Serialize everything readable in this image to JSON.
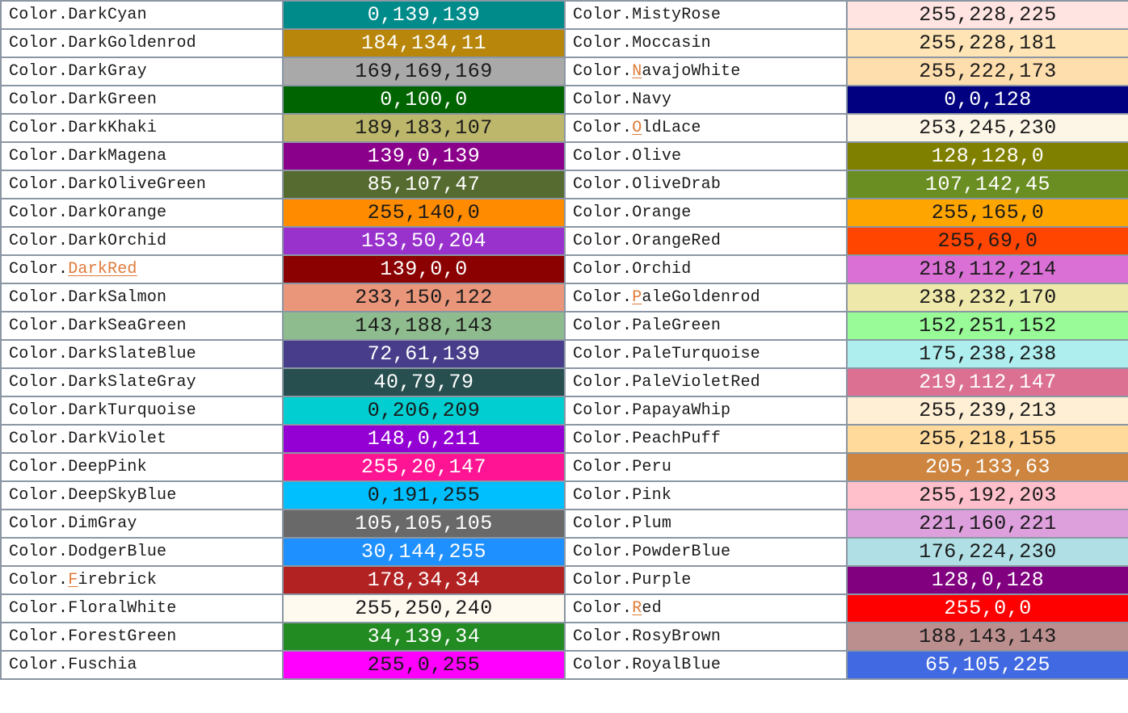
{
  "accent_color": "#e07b39",
  "rows": [
    {
      "left": {
        "prefix": "Color.",
        "name": "DarkCyan",
        "rgb": "0,139,139",
        "bg": "#008b8b",
        "fg": "#ffffff"
      },
      "right": {
        "prefix": "Color.",
        "name": "MistyRose",
        "rgb": "255,228,225",
        "bg": "#ffe4e1",
        "fg": "#1a1a1a"
      }
    },
    {
      "left": {
        "prefix": "Color.",
        "name": "DarkGoldenrod",
        "rgb": "184,134,11",
        "bg": "#b8860b",
        "fg": "#ffffff"
      },
      "right": {
        "prefix": "Color.",
        "name": "Moccasin",
        "rgb": "255,228,181",
        "bg": "#ffe4b5",
        "fg": "#1a1a1a"
      }
    },
    {
      "left": {
        "prefix": "Color.",
        "name": "DarkGray",
        "rgb": "169,169,169",
        "bg": "#a9a9a9",
        "fg": "#1a1a1a"
      },
      "right": {
        "prefix": "Color.",
        "name": "NavajoWhite",
        "rgb": "255,222,173",
        "bg": "#ffdead",
        "fg": "#1a1a1a",
        "mark": "first-letter"
      }
    },
    {
      "left": {
        "prefix": "Color.",
        "name": "DarkGreen",
        "rgb": "0,100,0",
        "bg": "#006400",
        "fg": "#ffffff"
      },
      "right": {
        "prefix": "Color.",
        "name": "Navy",
        "rgb": "0,0,128",
        "bg": "#000080",
        "fg": "#ffffff"
      }
    },
    {
      "left": {
        "prefix": "Color.",
        "name": "DarkKhaki",
        "rgb": "189,183,107",
        "bg": "#bdb76b",
        "fg": "#1a1a1a"
      },
      "right": {
        "prefix": "Color.",
        "name": "OldLace",
        "rgb": "253,245,230",
        "bg": "#fdf5e6",
        "fg": "#1a1a1a",
        "mark": "first-letter"
      }
    },
    {
      "left": {
        "prefix": "Color.",
        "name": "DarkMagena",
        "rgb": "139,0,139",
        "bg": "#8b008b",
        "fg": "#ffffff"
      },
      "right": {
        "prefix": "Color.",
        "name": "Olive",
        "rgb": "128,128,0",
        "bg": "#808000",
        "fg": "#ffffff"
      }
    },
    {
      "left": {
        "prefix": "Color.",
        "name": "DarkOliveGreen",
        "rgb": "85,107,47",
        "bg": "#556b2f",
        "fg": "#ffffff"
      },
      "right": {
        "prefix": "Color.",
        "name": "OliveDrab",
        "rgb": "107,142,45",
        "bg": "#6b8e23",
        "fg": "#ffffff"
      }
    },
    {
      "left": {
        "prefix": "Color.",
        "name": "DarkOrange",
        "rgb": "255,140,0",
        "bg": "#ff8c00",
        "fg": "#1a1a1a"
      },
      "right": {
        "prefix": "Color.",
        "name": "Orange",
        "rgb": "255,165,0",
        "bg": "#ffa500",
        "fg": "#1a1a1a"
      }
    },
    {
      "left": {
        "prefix": "Color.",
        "name": "DarkOrchid",
        "rgb": "153,50,204",
        "bg": "#9932cc",
        "fg": "#ffffff"
      },
      "right": {
        "prefix": "Color.",
        "name": "OrangeRed",
        "rgb": "255,69,0",
        "bg": "#ff4500",
        "fg": "#1a1a1a"
      }
    },
    {
      "left": {
        "prefix": "Color.",
        "name": "DarkRed",
        "rgb": "139,0,0",
        "bg": "#8b0000",
        "fg": "#ffffff",
        "mark": "whole"
      },
      "right": {
        "prefix": "Color.",
        "name": "Orchid",
        "rgb": "218,112,214",
        "bg": "#da70d6",
        "fg": "#1a1a1a"
      }
    },
    {
      "left": {
        "prefix": "Color.",
        "name": "DarkSalmon",
        "rgb": "233,150,122",
        "bg": "#e9967a",
        "fg": "#1a1a1a"
      },
      "right": {
        "prefix": "Color.",
        "name": "PaleGoldenrod",
        "rgb": "238,232,170",
        "bg": "#eee8aa",
        "fg": "#1a1a1a",
        "mark": "first-letter"
      }
    },
    {
      "left": {
        "prefix": "Color.",
        "name": "DarkSeaGreen",
        "rgb": "143,188,143",
        "bg": "#8fbc8f",
        "fg": "#1a1a1a"
      },
      "right": {
        "prefix": "Color.",
        "name": "PaleGreen",
        "rgb": "152,251,152",
        "bg": "#98fb98",
        "fg": "#1a1a1a"
      }
    },
    {
      "left": {
        "prefix": "Color.",
        "name": "DarkSlateBlue",
        "rgb": "72,61,139",
        "bg": "#483d8b",
        "fg": "#ffffff"
      },
      "right": {
        "prefix": "Color.",
        "name": "PaleTurquoise",
        "rgb": "175,238,238",
        "bg": "#afeeee",
        "fg": "#1a1a1a"
      }
    },
    {
      "left": {
        "prefix": "Color.",
        "name": "DarkSlateGray",
        "rgb": "40,79,79",
        "bg": "#284f4f",
        "fg": "#ffffff"
      },
      "right": {
        "prefix": "Color.",
        "name": "PaleVioletRed",
        "rgb": "219,112,147",
        "bg": "#db7093",
        "fg": "#ffffff"
      }
    },
    {
      "left": {
        "prefix": "Color.",
        "name": "DarkTurquoise",
        "rgb": "0,206,209",
        "bg": "#00ced1",
        "fg": "#1a1a1a"
      },
      "right": {
        "prefix": "Color.",
        "name": "PapayaWhip",
        "rgb": "255,239,213",
        "bg": "#ffefd5",
        "fg": "#1a1a1a"
      }
    },
    {
      "left": {
        "prefix": "Color.",
        "name": "DarkViolet",
        "rgb": "148,0,211",
        "bg": "#9400d3",
        "fg": "#ffffff"
      },
      "right": {
        "prefix": "Color.",
        "name": "PeachPuff",
        "rgb": "255,218,155",
        "bg": "#ffda9b",
        "fg": "#1a1a1a"
      }
    },
    {
      "left": {
        "prefix": "Color.",
        "name": "DeepPink",
        "rgb": "255,20,147",
        "bg": "#ff1493",
        "fg": "#ffffff"
      },
      "right": {
        "prefix": "Color.",
        "name": "Peru",
        "rgb": "205,133,63",
        "bg": "#cd853f",
        "fg": "#ffffff"
      }
    },
    {
      "left": {
        "prefix": "Color.",
        "name": "DeepSkyBlue",
        "rgb": "0,191,255",
        "bg": "#00bfff",
        "fg": "#1a1a1a"
      },
      "right": {
        "prefix": "Color.",
        "name": "Pink",
        "rgb": "255,192,203",
        "bg": "#ffc0cb",
        "fg": "#1a1a1a"
      }
    },
    {
      "left": {
        "prefix": "Color.",
        "name": "DimGray",
        "rgb": "105,105,105",
        "bg": "#696969",
        "fg": "#ffffff"
      },
      "right": {
        "prefix": "Color.",
        "name": "Plum",
        "rgb": "221,160,221",
        "bg": "#dda0dd",
        "fg": "#1a1a1a"
      }
    },
    {
      "left": {
        "prefix": "Color.",
        "name": "DodgerBlue",
        "rgb": "30,144,255",
        "bg": "#1e90ff",
        "fg": "#ffffff"
      },
      "right": {
        "prefix": "Color.",
        "name": "PowderBlue",
        "rgb": "176,224,230",
        "bg": "#b0e0e6",
        "fg": "#1a1a1a"
      }
    },
    {
      "left": {
        "prefix": "Color.",
        "name": "Firebrick",
        "rgb": "178,34,34",
        "bg": "#b22222",
        "fg": "#ffffff",
        "mark": "first-letter"
      },
      "right": {
        "prefix": "Color.",
        "name": "Purple",
        "rgb": "128,0,128",
        "bg": "#800080",
        "fg": "#ffffff"
      }
    },
    {
      "left": {
        "prefix": "Color.",
        "name": "FloralWhite",
        "rgb": "255,250,240",
        "bg": "#fffaf0",
        "fg": "#1a1a1a"
      },
      "right": {
        "prefix": "Color.",
        "name": "Red",
        "rgb": "255,0,0",
        "bg": "#ff0000",
        "fg": "#ffffff",
        "mark": "first-letter"
      }
    },
    {
      "left": {
        "prefix": "Color.",
        "name": "ForestGreen",
        "rgb": "34,139,34",
        "bg": "#228b22",
        "fg": "#ffffff"
      },
      "right": {
        "prefix": "Color.",
        "name": "RosyBrown",
        "rgb": "188,143,143",
        "bg": "#bc8f8f",
        "fg": "#1a1a1a"
      }
    },
    {
      "left": {
        "prefix": "Color.",
        "name": "Fuschia",
        "rgb": "255,0,255",
        "bg": "#ff00ff",
        "fg": "#1a1a1a"
      },
      "right": {
        "prefix": "Color.",
        "name": "RoyalBlue",
        "rgb": "65,105,225",
        "bg": "#4169e1",
        "fg": "#ffffff"
      }
    }
  ]
}
